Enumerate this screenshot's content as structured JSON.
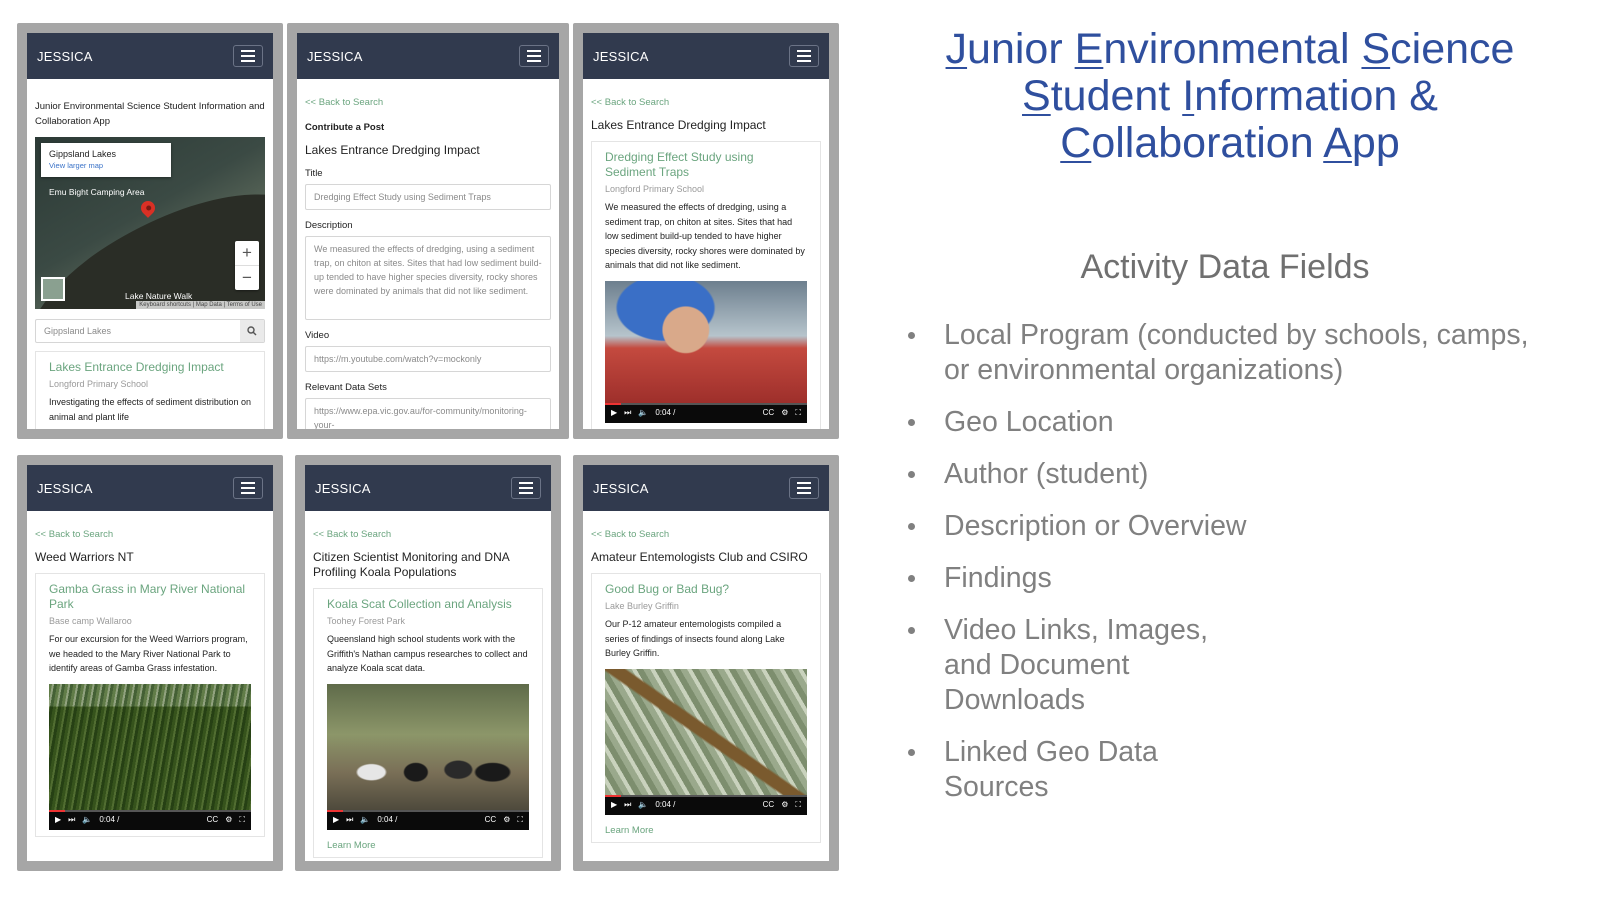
{
  "title": {
    "line1": "Junior Environmental Science",
    "line2": "Student Information &",
    "line3": "Collaboration App"
  },
  "subhead": "Activity Data Fields",
  "bullets": [
    {
      "text": "Local Program (conducted by schools, camps, or environmental organizations)"
    },
    {
      "text": "Geo Location"
    },
    {
      "text": "Author (student)"
    },
    {
      "text": "Description or Overview"
    },
    {
      "text": "Findings"
    },
    {
      "text": "Video Links, Images, and Document Downloads"
    },
    {
      "text": "Linked Geo Data Sources"
    }
  ],
  "brand": "JESSICA",
  "back_link": "<< Back to Search",
  "learn_more": "Learn More",
  "video_time": "0:04 /",
  "screen1": {
    "intro": "Junior Environmental Science Student Information and Collaboration App",
    "map_popup_title": "Gippsland Lakes",
    "map_popup_link": "View larger map",
    "map_poi": "Emu Bight Camping Area",
    "map_poi2": "Lake Nature Walk",
    "map_footer": "Keyboard shortcuts | Map Data | Terms of Use",
    "search_value": "Gippsland Lakes",
    "card_title": "Lakes Entrance Dredging Impact",
    "card_sub": "Longford Primary School",
    "card_body": "Investigating the effects of sediment distribution on animal and plant life"
  },
  "screen2": {
    "contribute": "Contribute a Post",
    "program": "Lakes Entrance Dredging Impact",
    "title_label": "Title",
    "title_value": "Dredging Effect Study using Sediment Traps",
    "desc_label": "Description",
    "desc_value": "We measured the effects of dredging, using a sediment trap, on chiton at sites. Sites that had low sediment build-up tended to have higher species diversity, rocky shores were dominated by animals that did not like sediment.",
    "video_label": "Video",
    "video_value": "https://m.youtube.com/watch?v=mockonly",
    "data_label": "Relevant Data Sets",
    "data_value": "https://www.epa.vic.gov.au/for-community/monitoring-your-"
  },
  "screen3": {
    "program": "Lakes Entrance Dredging Impact",
    "card_title": "Dredging Effect Study using Sediment Traps",
    "card_sub": "Longford Primary School",
    "card_body": "We measured the effects of dredging, using a sediment trap, on chiton at sites. Sites that had low sediment build-up tended to have higher species diversity, rocky shores were dominated by animals that did not like sediment."
  },
  "screen4": {
    "program": "Weed Warriors NT",
    "card_title": "Gamba Grass in Mary River National Park",
    "card_sub": "Base camp Wallaroo",
    "card_body": "For our excursion for the Weed Warriors program, we headed to the Mary River National Park to identify areas of Gamba Grass infestation."
  },
  "screen5": {
    "program": "Citizen Scientist Monitoring and DNA Profiling Koala Populations",
    "card_title": "Koala Scat Collection and Analysis",
    "card_sub": "Toohey Forest Park",
    "card_body": "Queensland high school students work with the Griffith's Nathan campus researches to collect and analyze Koala scat data."
  },
  "screen6": {
    "program": "Amateur Entemologists Club and CSIRO",
    "card_title": "Good Bug or Bad Bug?",
    "card_sub": "Lake Burley Griffin",
    "card_body": "Our P-12 amateur entemologists compiled a series of findings of insects found along Lake Burley Griffin."
  },
  "colors": {
    "navbar": "#313a4e",
    "link_green": "#6ba57f",
    "title_blue": "#2f4f9e",
    "bullet_grey": "#808080",
    "phone_frame": "#a6a6a6"
  }
}
